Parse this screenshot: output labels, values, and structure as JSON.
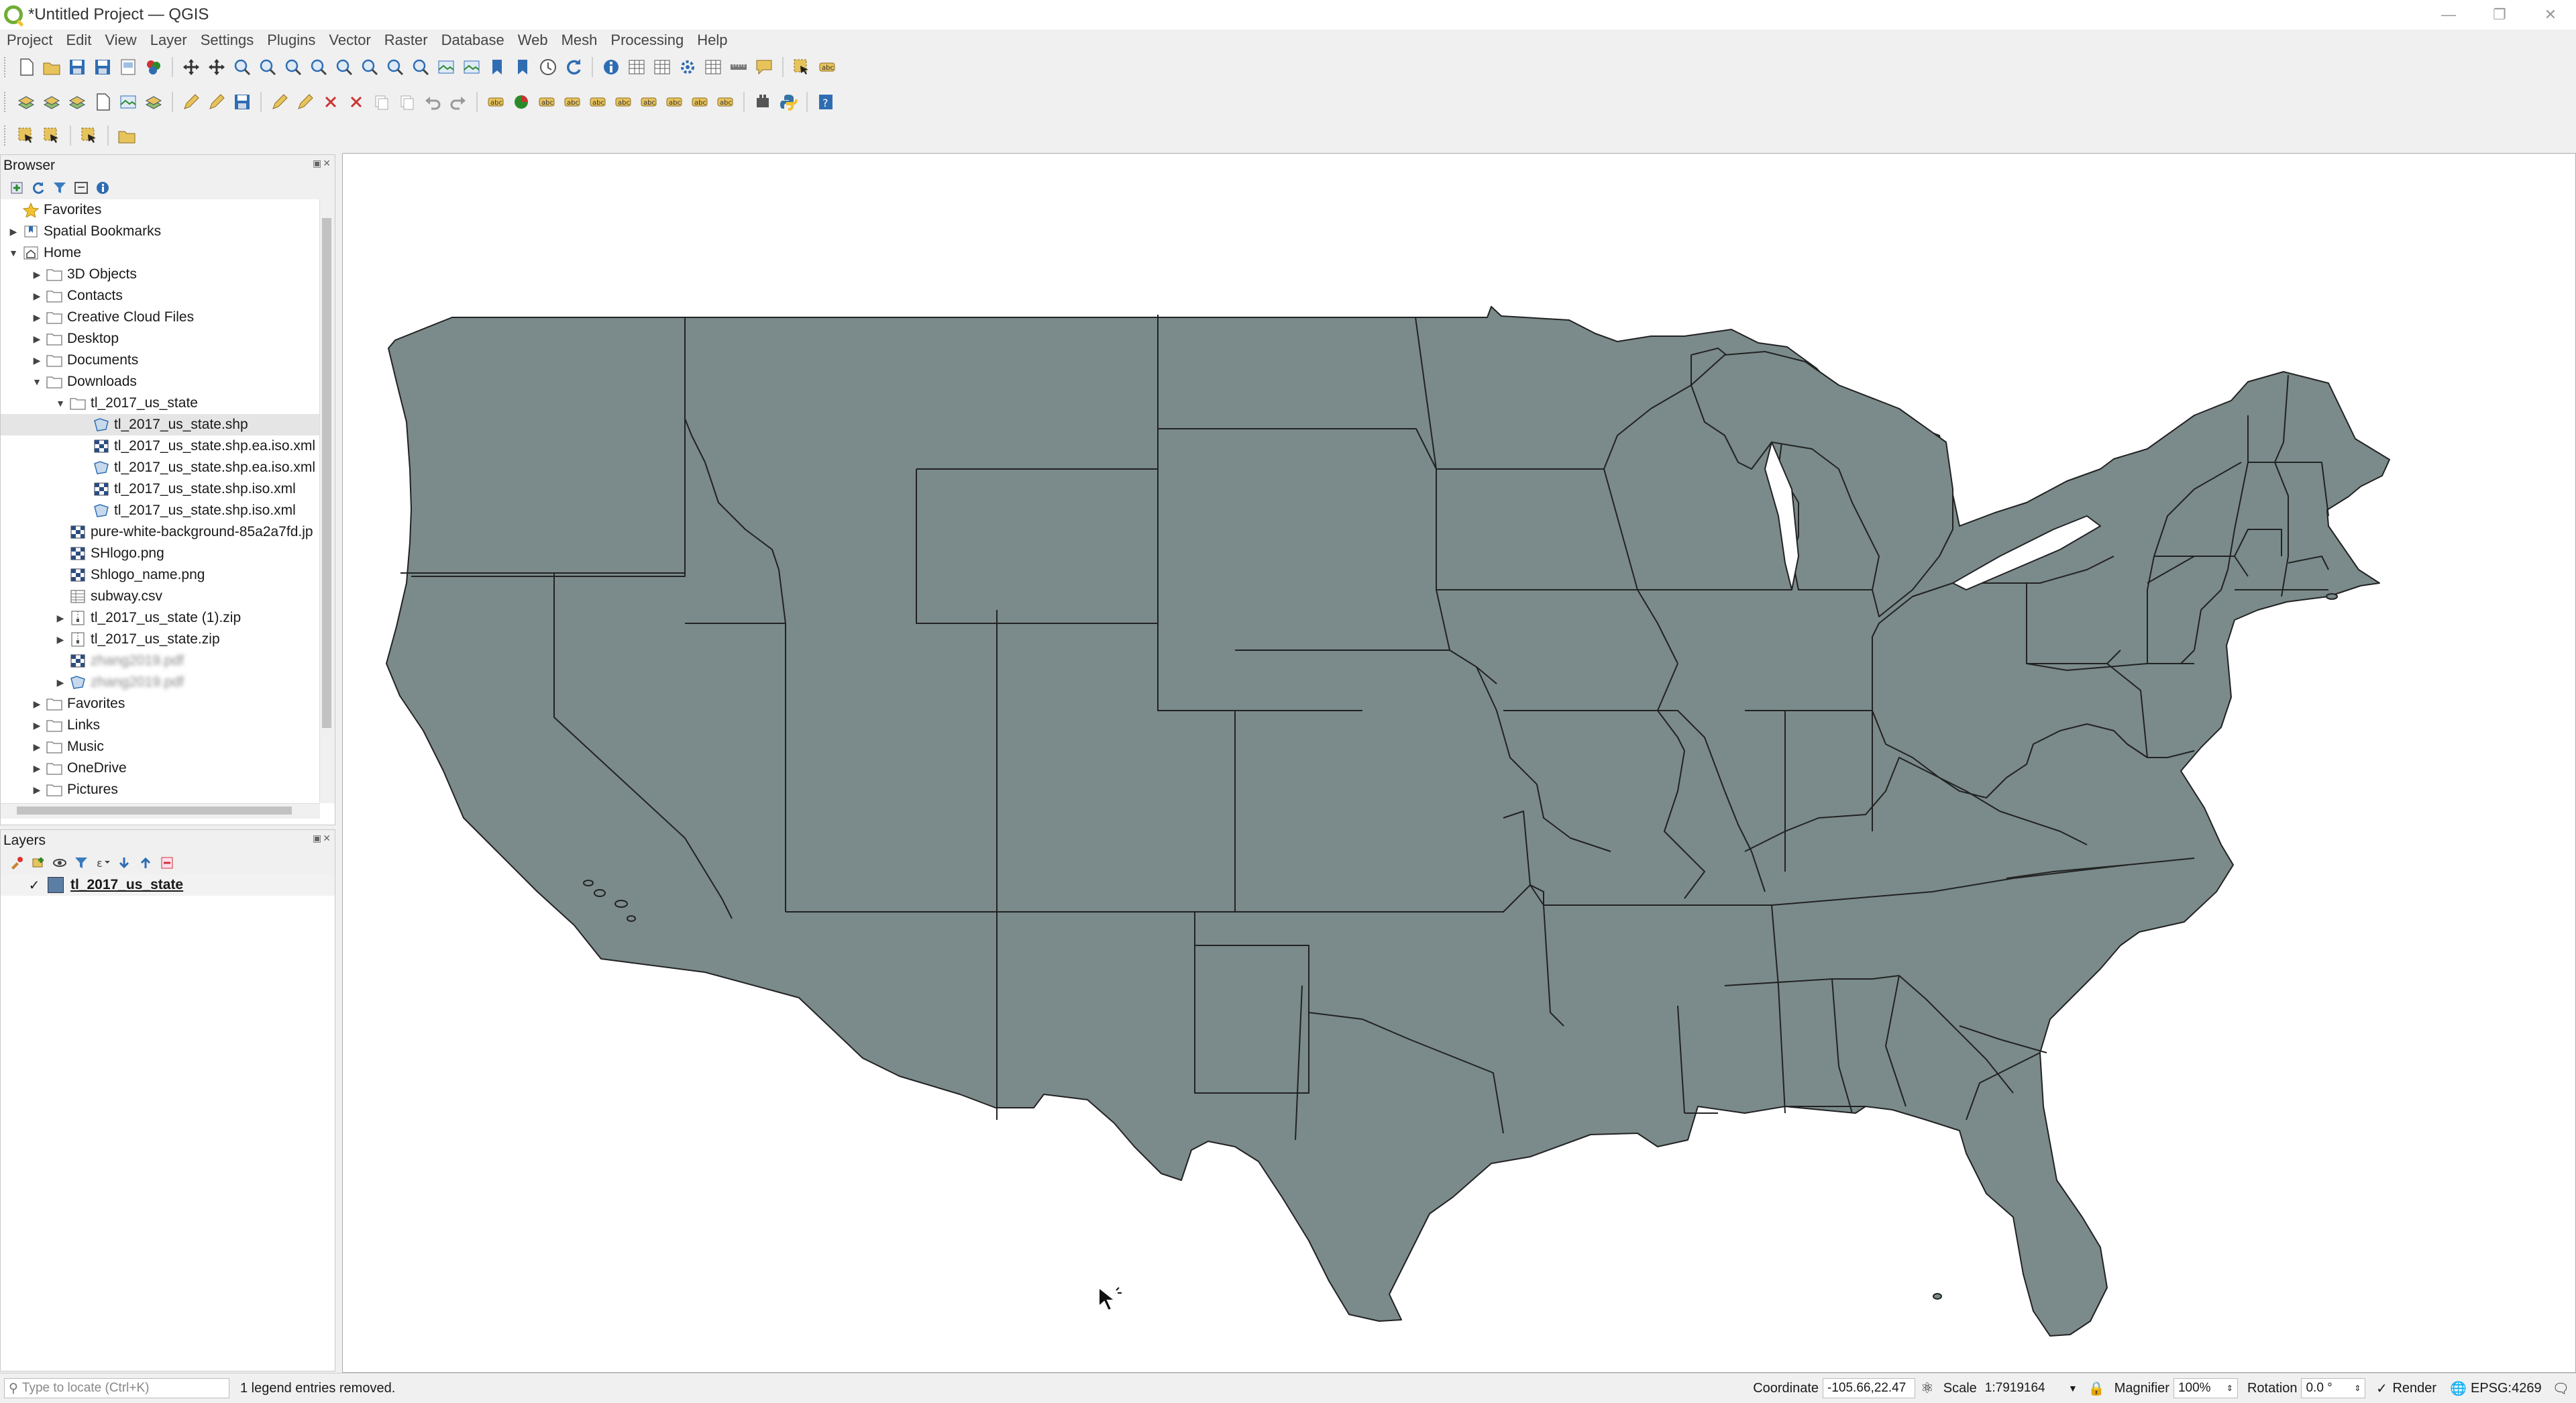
{
  "window": {
    "title": "*Untitled Project — QGIS"
  },
  "menu": [
    "Project",
    "Edit",
    "View",
    "Layer",
    "Settings",
    "Plugins",
    "Vector",
    "Raster",
    "Database",
    "Web",
    "Mesh",
    "Processing",
    "Help"
  ],
  "toolbar1": [
    "new-project-icon",
    "open-project-icon",
    "save-project-icon",
    "save-as-icon",
    "print-layout-icon",
    "style-manager-icon",
    "pan-icon",
    "pan-to-selection-icon",
    "zoom-in-icon",
    "zoom-out-icon",
    "zoom-full-icon",
    "zoom-selection-icon",
    "zoom-layer-icon",
    "zoom-native-icon",
    "zoom-last-icon",
    "zoom-next-icon",
    "new-map-view-icon",
    "new-3d-view-icon",
    "new-bookmark-icon",
    "show-bookmarks-icon",
    "temporal-controller-icon",
    "refresh-icon",
    "identify-icon",
    "attribute-table-icon",
    "field-calculator-icon",
    "processing-toolbox-icon",
    "statistics-icon",
    "measure-icon",
    "map-tips-icon",
    "select-tool-icon",
    "text-annotation-icon"
  ],
  "toolbar2": [
    "data-source-manager-icon",
    "add-vector-icon",
    "add-virtual-layer-icon",
    "new-layer-icon",
    "add-mesh-icon",
    "add-wms-icon",
    "current-edits-icon",
    "toggle-edit-icon",
    "save-edits-icon",
    "digitize-icon",
    "vertex-tool-icon",
    "delete-selected-icon",
    "cut-icon",
    "copy-icon",
    "paste-icon",
    "undo-icon",
    "redo-icon",
    "label-icon",
    "diagram-icon",
    "pin-label-icon",
    "show-hide-labels-icon",
    "move-label-icon",
    "rotate-label-icon",
    "change-label-icon",
    "label-tool-icon",
    "label-tool-icon",
    "label-tool-icon",
    "plugin-manager-icon",
    "python-console-icon",
    "help-icon"
  ],
  "toolbar3": [
    "select-features-icon",
    "select-by-value-icon",
    "deselect-icon",
    "open-annotation-icon"
  ],
  "browser": {
    "title": "Browser",
    "items": [
      {
        "label": "Favorites",
        "level": 0,
        "arrow": "",
        "icon": "star"
      },
      {
        "label": "Spatial Bookmarks",
        "level": 0,
        "arrow": "right",
        "icon": "bookmark"
      },
      {
        "label": "Home",
        "level": 0,
        "arrow": "down",
        "icon": "home"
      },
      {
        "label": "3D Objects",
        "level": 1,
        "arrow": "right",
        "icon": "folder"
      },
      {
        "label": "Contacts",
        "level": 1,
        "arrow": "right",
        "icon": "folder"
      },
      {
        "label": "Creative Cloud Files",
        "level": 1,
        "arrow": "right",
        "icon": "folder"
      },
      {
        "label": "Desktop",
        "level": 1,
        "arrow": "right",
        "icon": "folder"
      },
      {
        "label": "Documents",
        "level": 1,
        "arrow": "right",
        "icon": "folder"
      },
      {
        "label": "Downloads",
        "level": 1,
        "arrow": "down",
        "icon": "folder"
      },
      {
        "label": "tl_2017_us_state",
        "level": 2,
        "arrow": "down",
        "icon": "folder"
      },
      {
        "label": "tl_2017_us_state.shp",
        "level": 3,
        "arrow": "",
        "icon": "polygon",
        "selected": true
      },
      {
        "label": "tl_2017_us_state.shp.ea.iso.xml",
        "level": 3,
        "arrow": "",
        "icon": "raster"
      },
      {
        "label": "tl_2017_us_state.shp.ea.iso.xml",
        "level": 3,
        "arrow": "",
        "icon": "polygon"
      },
      {
        "label": "tl_2017_us_state.shp.iso.xml",
        "level": 3,
        "arrow": "",
        "icon": "raster"
      },
      {
        "label": "tl_2017_us_state.shp.iso.xml",
        "level": 3,
        "arrow": "",
        "icon": "polygon"
      },
      {
        "label": "pure-white-background-85a2a7fd.jp",
        "level": 2,
        "arrow": "",
        "icon": "raster"
      },
      {
        "label": "SHlogo.png",
        "level": 2,
        "arrow": "",
        "icon": "raster"
      },
      {
        "label": "Shlogo_name.png",
        "level": 2,
        "arrow": "",
        "icon": "raster"
      },
      {
        "label": "subway.csv",
        "level": 2,
        "arrow": "",
        "icon": "table"
      },
      {
        "label": "tl_2017_us_state (1).zip",
        "level": 2,
        "arrow": "right",
        "icon": "zip"
      },
      {
        "label": "tl_2017_us_state.zip",
        "level": 2,
        "arrow": "right",
        "icon": "zip"
      },
      {
        "label": "zhang2019.pdf",
        "level": 2,
        "arrow": "",
        "icon": "raster",
        "blurred": true
      },
      {
        "label": "zhang2019.pdf",
        "level": 2,
        "arrow": "right",
        "icon": "polygon",
        "blurred": true
      },
      {
        "label": "Favorites",
        "level": 1,
        "arrow": "right",
        "icon": "folder"
      },
      {
        "label": "Links",
        "level": 1,
        "arrow": "right",
        "icon": "folder"
      },
      {
        "label": "Music",
        "level": 1,
        "arrow": "right",
        "icon": "folder"
      },
      {
        "label": "OneDrive",
        "level": 1,
        "arrow": "right",
        "icon": "folder"
      },
      {
        "label": "Pictures",
        "level": 1,
        "arrow": "right",
        "icon": "folder"
      }
    ]
  },
  "layers": {
    "title": "Layers",
    "items": [
      {
        "label": "tl_2017_us_state",
        "checked": true,
        "color": "#5b7ea4"
      }
    ]
  },
  "map": {
    "fill": "#7b8a8b",
    "stroke": "#222222",
    "background": "#ffffff"
  },
  "status": {
    "locator_placeholder": "Type to locate (Ctrl+K)",
    "message": "1 legend entries removed.",
    "coordinate_label": "Coordinate",
    "coordinate": "-105.66,22.47",
    "scale_label": "Scale",
    "scale": "1:7919164",
    "magnifier_label": "Magnifier",
    "magnifier": "100%",
    "rotation_label": "Rotation",
    "rotation": "0.0 °",
    "render_label": "Render",
    "crs": "EPSG:4269"
  }
}
